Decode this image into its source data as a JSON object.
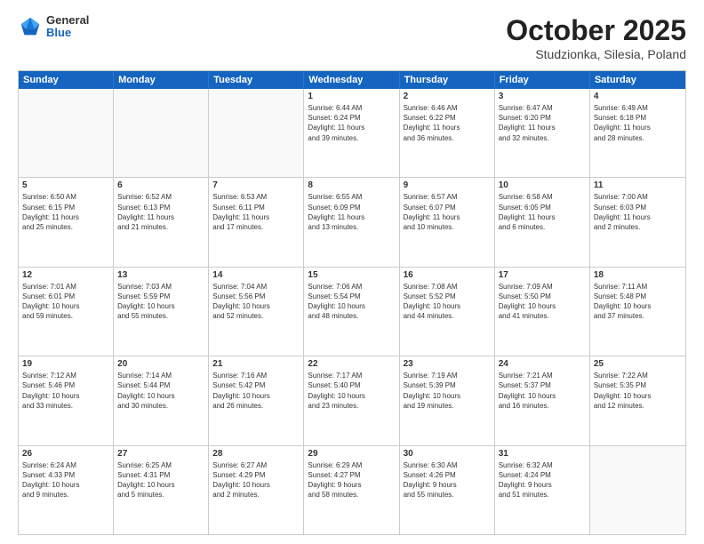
{
  "header": {
    "logo_general": "General",
    "logo_blue": "Blue",
    "title": "October 2025",
    "subtitle": "Studzionka, Silesia, Poland"
  },
  "weekdays": [
    "Sunday",
    "Monday",
    "Tuesday",
    "Wednesday",
    "Thursday",
    "Friday",
    "Saturday"
  ],
  "weeks": [
    [
      {
        "day": "",
        "info": ""
      },
      {
        "day": "",
        "info": ""
      },
      {
        "day": "",
        "info": ""
      },
      {
        "day": "1",
        "info": "Sunrise: 6:44 AM\nSunset: 6:24 PM\nDaylight: 11 hours\nand 39 minutes."
      },
      {
        "day": "2",
        "info": "Sunrise: 6:46 AM\nSunset: 6:22 PM\nDaylight: 11 hours\nand 36 minutes."
      },
      {
        "day": "3",
        "info": "Sunrise: 6:47 AM\nSunset: 6:20 PM\nDaylight: 11 hours\nand 32 minutes."
      },
      {
        "day": "4",
        "info": "Sunrise: 6:49 AM\nSunset: 6:18 PM\nDaylight: 11 hours\nand 28 minutes."
      }
    ],
    [
      {
        "day": "5",
        "info": "Sunrise: 6:50 AM\nSunset: 6:15 PM\nDaylight: 11 hours\nand 25 minutes."
      },
      {
        "day": "6",
        "info": "Sunrise: 6:52 AM\nSunset: 6:13 PM\nDaylight: 11 hours\nand 21 minutes."
      },
      {
        "day": "7",
        "info": "Sunrise: 6:53 AM\nSunset: 6:11 PM\nDaylight: 11 hours\nand 17 minutes."
      },
      {
        "day": "8",
        "info": "Sunrise: 6:55 AM\nSunset: 6:09 PM\nDaylight: 11 hours\nand 13 minutes."
      },
      {
        "day": "9",
        "info": "Sunrise: 6:57 AM\nSunset: 6:07 PM\nDaylight: 11 hours\nand 10 minutes."
      },
      {
        "day": "10",
        "info": "Sunrise: 6:58 AM\nSunset: 6:05 PM\nDaylight: 11 hours\nand 6 minutes."
      },
      {
        "day": "11",
        "info": "Sunrise: 7:00 AM\nSunset: 6:03 PM\nDaylight: 11 hours\nand 2 minutes."
      }
    ],
    [
      {
        "day": "12",
        "info": "Sunrise: 7:01 AM\nSunset: 6:01 PM\nDaylight: 10 hours\nand 59 minutes."
      },
      {
        "day": "13",
        "info": "Sunrise: 7:03 AM\nSunset: 5:59 PM\nDaylight: 10 hours\nand 55 minutes."
      },
      {
        "day": "14",
        "info": "Sunrise: 7:04 AM\nSunset: 5:56 PM\nDaylight: 10 hours\nand 52 minutes."
      },
      {
        "day": "15",
        "info": "Sunrise: 7:06 AM\nSunset: 5:54 PM\nDaylight: 10 hours\nand 48 minutes."
      },
      {
        "day": "16",
        "info": "Sunrise: 7:08 AM\nSunset: 5:52 PM\nDaylight: 10 hours\nand 44 minutes."
      },
      {
        "day": "17",
        "info": "Sunrise: 7:09 AM\nSunset: 5:50 PM\nDaylight: 10 hours\nand 41 minutes."
      },
      {
        "day": "18",
        "info": "Sunrise: 7:11 AM\nSunset: 5:48 PM\nDaylight: 10 hours\nand 37 minutes."
      }
    ],
    [
      {
        "day": "19",
        "info": "Sunrise: 7:12 AM\nSunset: 5:46 PM\nDaylight: 10 hours\nand 33 minutes."
      },
      {
        "day": "20",
        "info": "Sunrise: 7:14 AM\nSunset: 5:44 PM\nDaylight: 10 hours\nand 30 minutes."
      },
      {
        "day": "21",
        "info": "Sunrise: 7:16 AM\nSunset: 5:42 PM\nDaylight: 10 hours\nand 26 minutes."
      },
      {
        "day": "22",
        "info": "Sunrise: 7:17 AM\nSunset: 5:40 PM\nDaylight: 10 hours\nand 23 minutes."
      },
      {
        "day": "23",
        "info": "Sunrise: 7:19 AM\nSunset: 5:39 PM\nDaylight: 10 hours\nand 19 minutes."
      },
      {
        "day": "24",
        "info": "Sunrise: 7:21 AM\nSunset: 5:37 PM\nDaylight: 10 hours\nand 16 minutes."
      },
      {
        "day": "25",
        "info": "Sunrise: 7:22 AM\nSunset: 5:35 PM\nDaylight: 10 hours\nand 12 minutes."
      }
    ],
    [
      {
        "day": "26",
        "info": "Sunrise: 6:24 AM\nSunset: 4:33 PM\nDaylight: 10 hours\nand 9 minutes."
      },
      {
        "day": "27",
        "info": "Sunrise: 6:25 AM\nSunset: 4:31 PM\nDaylight: 10 hours\nand 5 minutes."
      },
      {
        "day": "28",
        "info": "Sunrise: 6:27 AM\nSunset: 4:29 PM\nDaylight: 10 hours\nand 2 minutes."
      },
      {
        "day": "29",
        "info": "Sunrise: 6:29 AM\nSunset: 4:27 PM\nDaylight: 9 hours\nand 58 minutes."
      },
      {
        "day": "30",
        "info": "Sunrise: 6:30 AM\nSunset: 4:26 PM\nDaylight: 9 hours\nand 55 minutes."
      },
      {
        "day": "31",
        "info": "Sunrise: 6:32 AM\nSunset: 4:24 PM\nDaylight: 9 hours\nand 51 minutes."
      },
      {
        "day": "",
        "info": ""
      }
    ]
  ]
}
